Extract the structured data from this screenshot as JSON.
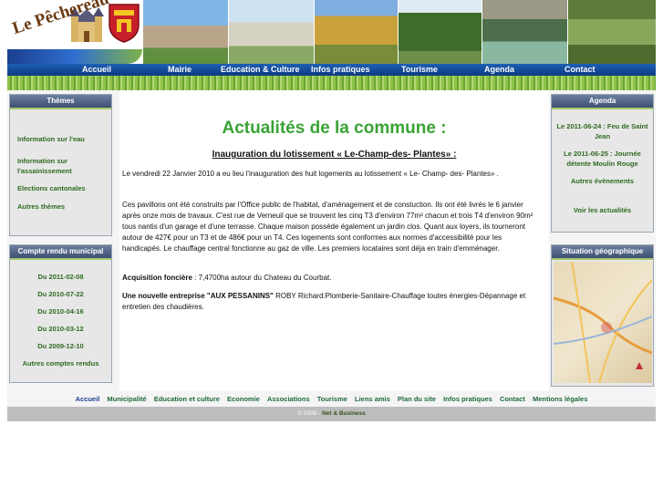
{
  "header": {
    "site_title": "Le Pêchereau"
  },
  "nav": {
    "items": [
      "Accueil",
      "Mairie",
      "Education & Culture",
      "Infos pratiques",
      "Tourisme",
      "Agenda",
      "Contact"
    ]
  },
  "themes": {
    "title": "Thèmes",
    "items": [
      "Information sur l'eau",
      "Information sur l'assainissement",
      "Elections cantonales",
      "Autres thèmes"
    ]
  },
  "compte_rendu": {
    "title": "Compte rendu municipal",
    "items": [
      "Du 2011-02-08",
      "Du 2010-07-22",
      "Du 2010-04-16",
      "Du 2010-03-12",
      "Du 2009-12-10",
      "Autres comptes rendus"
    ]
  },
  "agenda": {
    "title": "Agenda",
    "event1": "Le 2011-06-24 : Feu de Saint Jean",
    "event2": "Le 2011-06-25 : Journée détente Moulin Rouge",
    "more_events": "Autres évènements",
    "news_link": "Voir les actualités"
  },
  "situation": {
    "title": "Situation géographique"
  },
  "main": {
    "title": "Actualités de la commune :",
    "subtitle": "Inauguration du lotissement « Le-Champ-des- Plantes» :",
    "para1": "Le  vendredi 22 Janvier 2010 a eu lieu l'inauguration des huit logements au lotissement « Le- Champ- des- Plantes» .",
    "para2": "Ces pavillons ont été construits par l'Office public de l'habitat, d'aménagement et de constuction. Ils ont été livrés le 6 janvier après onze mois de travaux. C'est rue de Verneuil que se trouvent les cinq T3 d'environ 77m² chacun et trois T4 d'environ 90m² tous nantis d'un garage et d'une terrasse. Chaque maison possède également un jardin clos. Quant aux loyers, ils tourneront autour de 427€ pour un T3 et de 486€ pour un T4. Ces logements sont conformes aux normes d'accessibilité pour les handicapés. Le chauffage central fonctionne au gaz de ville. Les premiers locataires sont déja en train d'emménager.",
    "para3_label": "Acquisition foncière",
    "para3_text": " : 7,4700ha autour du Chateau du Courbat.",
    "para4_label": "Une nouvelle entreprise \"AUX PESSANINS\"",
    "para4_text": " ROBY Richard:Plomberie-Sanitaire-Chauffage toutes énergies-Dépannage et entretien des chaudières."
  },
  "footer": {
    "links": [
      "Accueil",
      "Municipalité",
      "Education et culture",
      "Economie",
      "Associations",
      "Tourisme",
      "Liens amis",
      "Plan du site",
      "Infos pratiques",
      "Contact",
      "Mentions légales"
    ],
    "copyright": "© 2008 - ",
    "brand": "Net & Business"
  },
  "colors": {
    "nav_bg": "#1d5fb3",
    "heading_green": "#3aa336",
    "link_green": "#2e6b21"
  }
}
